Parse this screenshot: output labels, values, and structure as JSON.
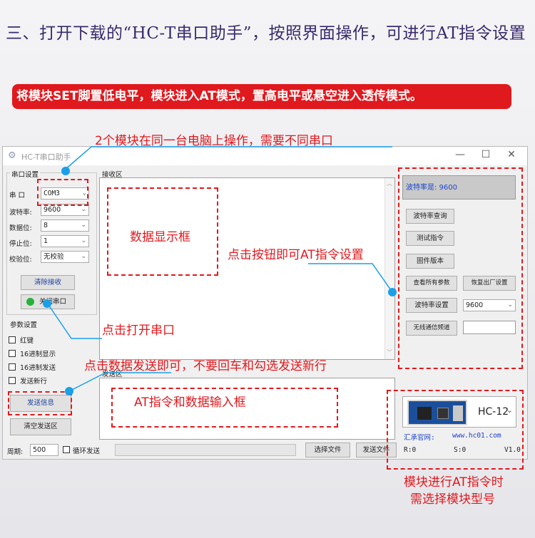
{
  "heading": "三、打开下载的“HC-T串口助手”，按照界面操作，可进行AT指令设置",
  "banner": "将模块SET脚置低电平，模块进入AT模式，置高电平或悬空进入透传模式。",
  "annotations": {
    "different_ports": "2个模块在同一台电脑上操作，需要不同串口",
    "data_display": "数据显示框",
    "click_button_at": "点击按钮即可AT指令设置",
    "open_port": "点击打开串口",
    "send_data": "点击数据发送即可，不要回车和勾选发送新行",
    "at_input": "AT指令和数据输入框",
    "select_model_1": "模块进行AT指令时",
    "select_model_2": "需选择模块型号"
  },
  "window": {
    "title": "HC-T串口助手",
    "controls": {
      "minimize": "—",
      "maximize": "☐",
      "close": "✕"
    },
    "serial_group": "串口设置",
    "port_label": "串 口",
    "port_value": "COM3",
    "baud_label": "波特率:",
    "baud_value": "9600",
    "databits_label": "数据位:",
    "databits_value": "8",
    "stopbits_label": "停止位:",
    "stopbits_value": "1",
    "parity_label": "校验位:",
    "parity_value": "无校验",
    "clear_receive": "清除接收",
    "close_port": "关闭串口",
    "param_group": "参数设置",
    "checkboxes": [
      "红键",
      "16进制显示",
      "16进制发送",
      "发送新行"
    ],
    "receive_area": "接收区",
    "send_area": "发送区",
    "send_button": "发送信息",
    "clear_send": "清空发送区",
    "period_label": "周期:",
    "period_value": "500",
    "loop_send": "循环发送",
    "choose_file": "选择文件",
    "send_file": "发送文件",
    "baud_display": "波特率是: 9600",
    "query_baud": "波特率查询",
    "test_cmd": "测试指令",
    "firmware": "固件版本",
    "view_params": "查看所有参数",
    "factory_reset": "恢复出厂设置",
    "set_baud": "波特率设置",
    "set_baud_value": "9600",
    "wireless_channel": "无线通信频道",
    "module_name": "HC-12",
    "website_label": "汇承官网:",
    "website": "www.hc01.com",
    "status_r": "R:0",
    "status_s": "S:0",
    "version": "V1.0"
  },
  "colors": {
    "annotation": "#e0191e",
    "pointer": "#1aa0e8",
    "heading": "#3a2a6e",
    "link": "#1a3fcf"
  }
}
